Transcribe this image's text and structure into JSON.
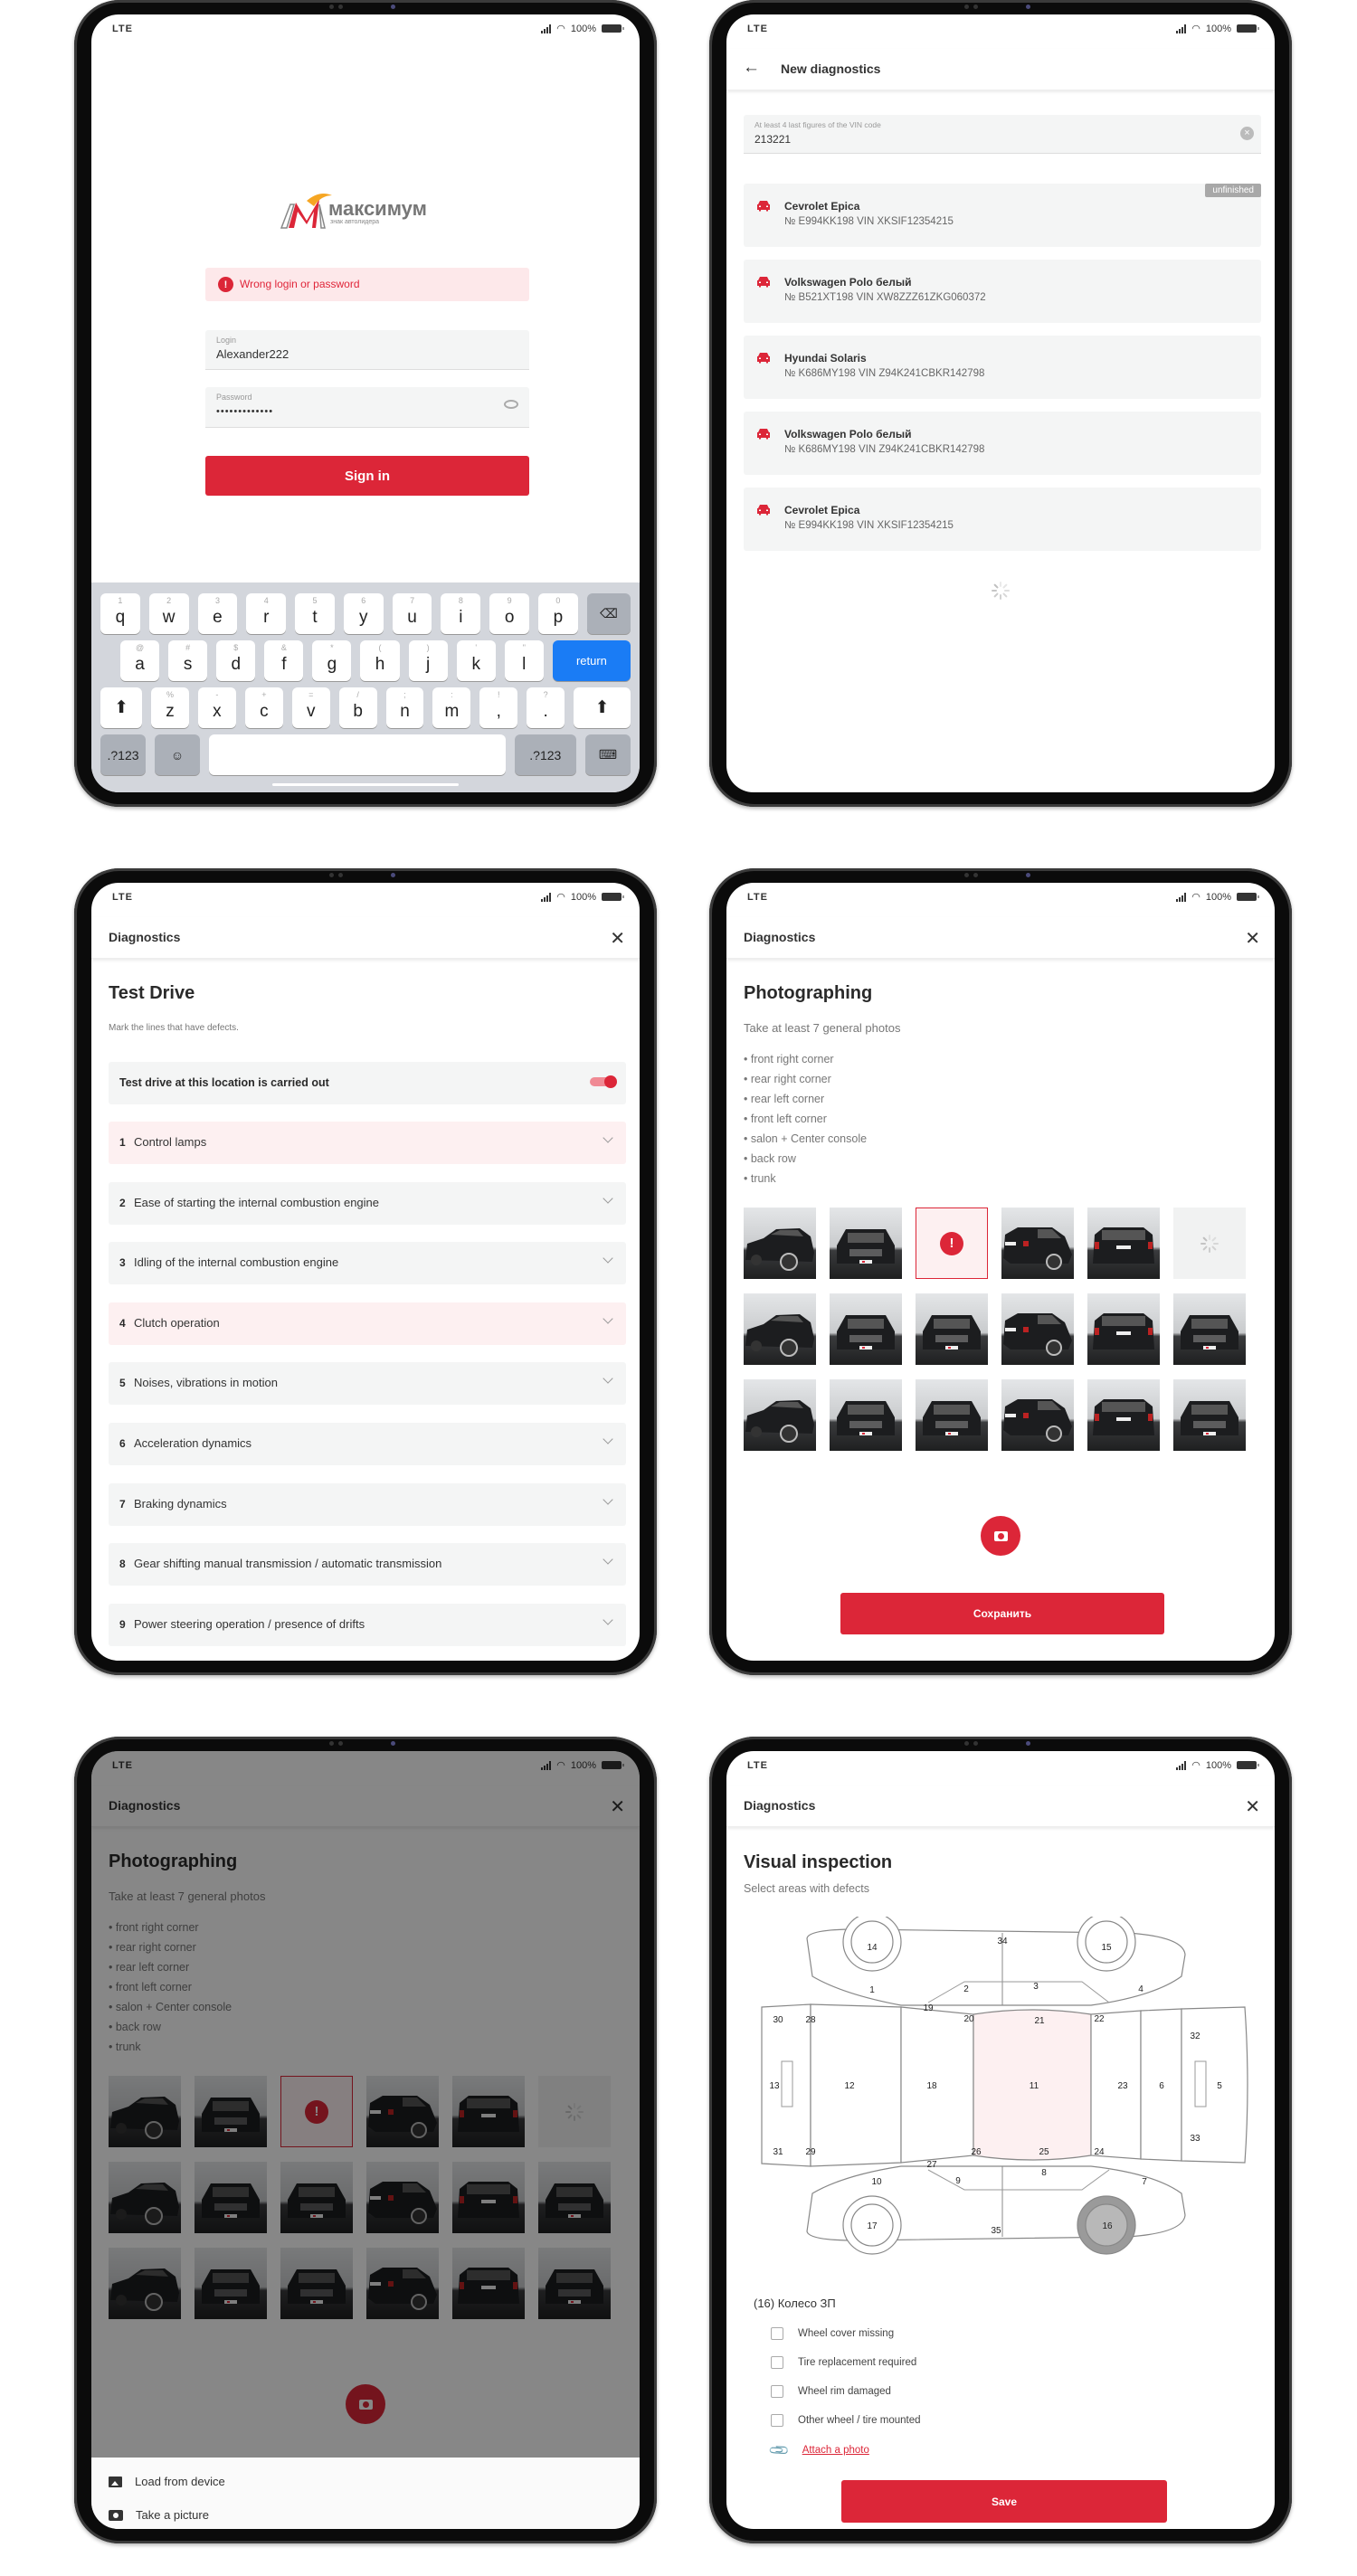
{
  "status_bar": {
    "network": "LTE",
    "battery": "100%"
  },
  "colors": {
    "accent": "#dc2638",
    "error_bg": "#fde8ea",
    "row_bg": "#f4f5f5",
    "defect_bg": "#fdf0f1",
    "keyboard_return": "#1a7cf5"
  },
  "login": {
    "logo": {
      "brand": "максимум",
      "tagline": "знак автолидера"
    },
    "error": "Wrong login or password",
    "login_label": "Login",
    "login_value": "Alexander222",
    "password_label": "Password",
    "password_value": "•••••••••••••",
    "sign_in": "Sign in",
    "keyboard": {
      "row1": [
        {
          "k": "q",
          "h": "1"
        },
        {
          "k": "w",
          "h": "2"
        },
        {
          "k": "e",
          "h": "3"
        },
        {
          "k": "r",
          "h": "4"
        },
        {
          "k": "t",
          "h": "5"
        },
        {
          "k": "y",
          "h": "6"
        },
        {
          "k": "u",
          "h": "7"
        },
        {
          "k": "i",
          "h": "8"
        },
        {
          "k": "o",
          "h": "9"
        },
        {
          "k": "p",
          "h": "0"
        }
      ],
      "row2": [
        {
          "k": "a",
          "h": "@"
        },
        {
          "k": "s",
          "h": "#"
        },
        {
          "k": "d",
          "h": "$"
        },
        {
          "k": "f",
          "h": "&"
        },
        {
          "k": "g",
          "h": "*"
        },
        {
          "k": "h",
          "h": "("
        },
        {
          "k": "j",
          "h": ")"
        },
        {
          "k": "k",
          "h": "'"
        },
        {
          "k": "l",
          "h": "\""
        }
      ],
      "row3": [
        {
          "k": "z",
          "h": "%"
        },
        {
          "k": "x",
          "h": "-"
        },
        {
          "k": "c",
          "h": "+"
        },
        {
          "k": "v",
          "h": "="
        },
        {
          "k": "b",
          "h": "/"
        },
        {
          "k": "n",
          "h": ";"
        },
        {
          "k": "m",
          "h": ":"
        },
        {
          "k": ",",
          "h": "!"
        },
        {
          "k": ".",
          "h": "?"
        }
      ],
      "return": "return",
      "symbols": ".?123"
    }
  },
  "vin_search": {
    "title": "New diagnostics",
    "search_label": "At least 4 last figures of the VIN code",
    "search_value": "213221",
    "results": [
      {
        "name": "Cevrolet Epica",
        "details": "№ E994KK198 VIN XKSIF12354215",
        "badge": "unfinished"
      },
      {
        "name": "Volkswagen Polo белый",
        "details": "№ B521XT198 VIN XW8ZZZ61ZKG060372"
      },
      {
        "name": "Hyundai Solaris",
        "details": "№ K686MY198 VIN Z94K241CBKR142798"
      },
      {
        "name": "Volkswagen Polo белый",
        "details": "№ K686MY198 VIN Z94K241CBKR142798"
      },
      {
        "name": "Cevrolet Epica",
        "details": "№ E994KK198 VIN XKSIF12354215"
      }
    ]
  },
  "test_drive": {
    "header": "Diagnostics",
    "title": "Test Drive",
    "subtitle": "Mark the lines that have defects.",
    "toggle_label": "Test drive at this location is carried out",
    "toggle_on": true,
    "items": [
      {
        "num": "1",
        "label": "Control lamps",
        "defect": true
      },
      {
        "num": "2",
        "label": "Ease of starting the internal combustion engine",
        "defect": false
      },
      {
        "num": "3",
        "label": "Idling of the internal combustion engine",
        "defect": false
      },
      {
        "num": "4",
        "label": "Clutch operation",
        "defect": true
      },
      {
        "num": "5",
        "label": "Noises, vibrations in motion",
        "defect": false
      },
      {
        "num": "6",
        "label": "Acceleration dynamics",
        "defect": false
      },
      {
        "num": "7",
        "label": "Braking dynamics",
        "defect": false
      },
      {
        "num": "8",
        "label": "Gear shifting manual transmission / automatic transmission",
        "defect": false
      },
      {
        "num": "9",
        "label": "Power steering operation / presence of drifts",
        "defect": false
      }
    ]
  },
  "photographing": {
    "header": "Diagnostics",
    "title": "Photographing",
    "subtitle": "Take at least 7 general photos",
    "bullets": [
      "• front right corner",
      "• rear right corner",
      "• rear left corner",
      "• front left corner",
      "• salon + Center console",
      "• back row",
      "• trunk"
    ],
    "photos": [
      [
        "side",
        "front",
        "error",
        "rear-side",
        "rear",
        "loading"
      ],
      [
        "side",
        "front",
        "front",
        "rear-side",
        "rear",
        "front"
      ],
      [
        "side",
        "front",
        "front",
        "rear-side",
        "rear",
        "front"
      ]
    ],
    "save": "Сохранить"
  },
  "photo_source_sheet": {
    "load_from_device": "Load from device",
    "take_picture": "Take a picture"
  },
  "visual_inspection": {
    "header": "Diagnostics",
    "title": "Visual inspection",
    "subtitle": "Select areas with defects",
    "zones": [
      "1",
      "2",
      "3",
      "4",
      "5",
      "6",
      "7",
      "8",
      "9",
      "10",
      "11",
      "12",
      "13",
      "14",
      "15",
      "16",
      "17",
      "18",
      "19",
      "20",
      "21",
      "22",
      "23",
      "24",
      "25",
      "26",
      "27",
      "28",
      "29",
      "30",
      "31",
      "32",
      "33",
      "34",
      "35"
    ],
    "selected_zone": "16",
    "highlighted_zone": "11",
    "selected_title": "(16) Колесо ЗП",
    "options": [
      "Wheel cover missing",
      "Tire replacement required",
      "Wheel rim damaged",
      "Other wheel / tire mounted"
    ],
    "attach": "Attach a photo",
    "save": "Save"
  }
}
